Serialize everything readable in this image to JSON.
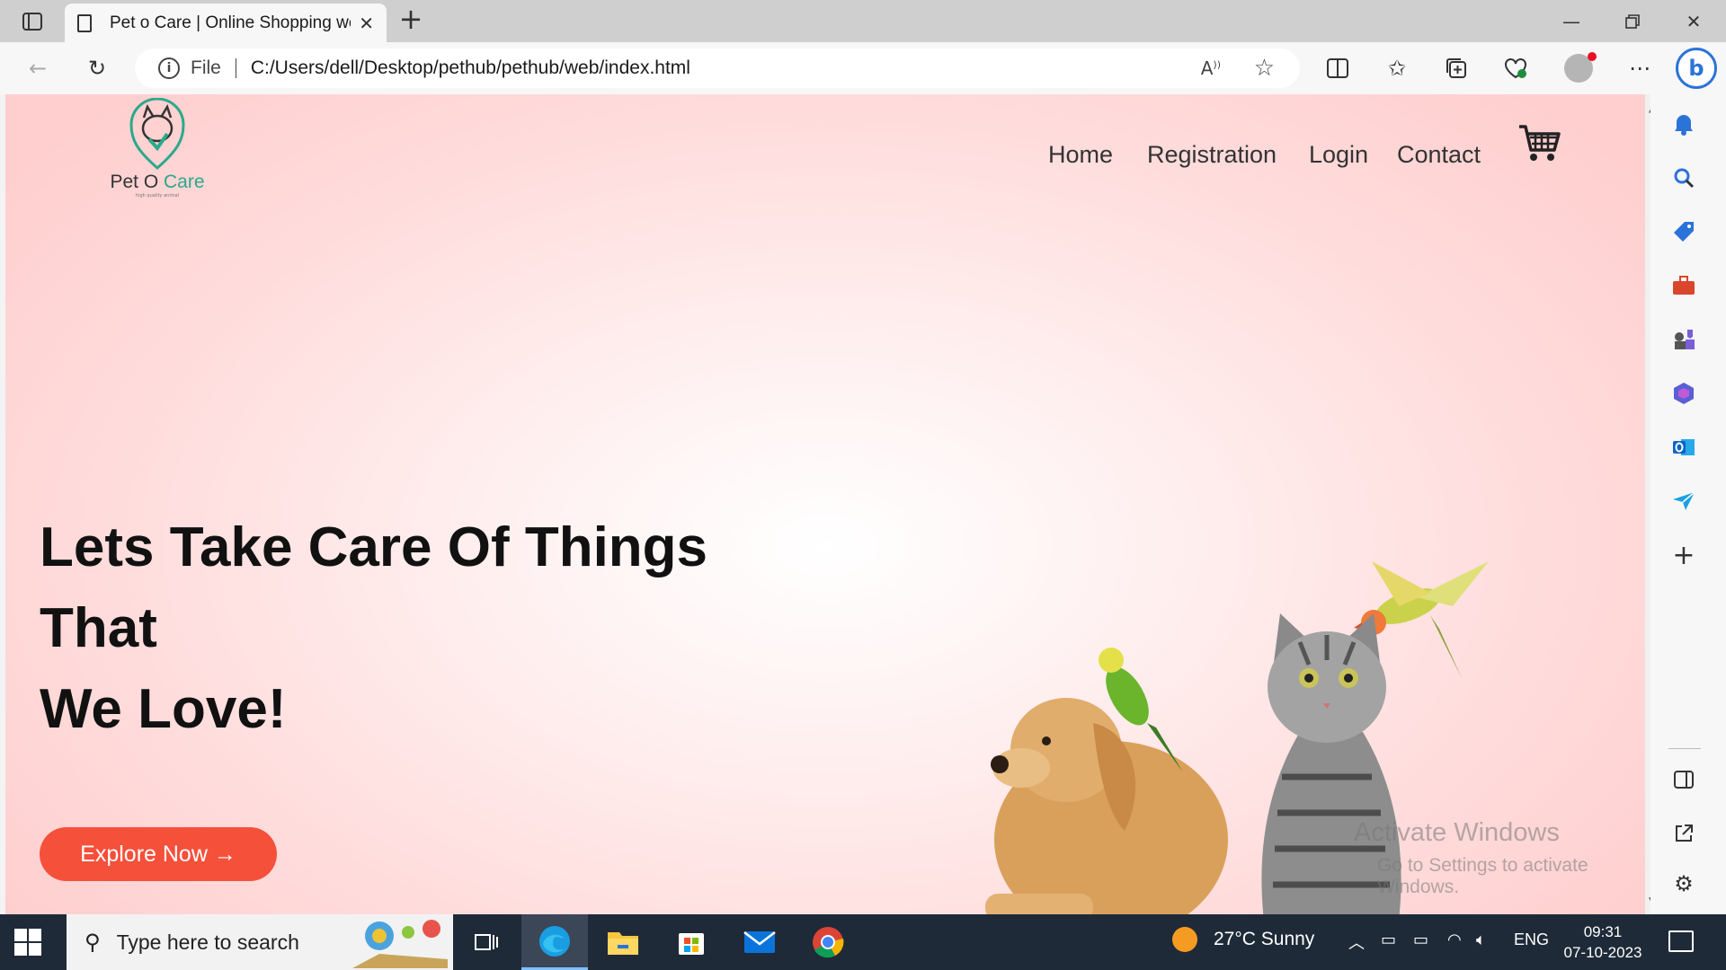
{
  "browser": {
    "tab_title": "Pet o Care | Online Shopping website",
    "url_scheme": "File",
    "url": "C:/Users/dell/Desktop/pethub/pethub/web/index.html"
  },
  "page": {
    "logo": {
      "brand_part1": "Pet O ",
      "brand_part2": "Care",
      "tagline": "high quality animal"
    },
    "nav": {
      "home": "Home",
      "registration": "Registration",
      "login": "Login",
      "contact": "Contact"
    },
    "hero": {
      "line1": "Lets Take Care Of Things",
      "line2": "That",
      "line3": "We Love!",
      "cta": "Explore Now →"
    }
  },
  "watermark": {
    "line1": "Activate Windows",
    "line2": "Go to Settings to activate Windows."
  },
  "taskbar": {
    "search_placeholder": "Type here to search",
    "weather": "27°C  Sunny",
    "language": "ENG",
    "time": "09:31",
    "date": "07-10-2023"
  },
  "colors": {
    "accent": "#f5503a",
    "brand_green": "#2aa98b",
    "hero_bg": "#ffd6d6"
  }
}
